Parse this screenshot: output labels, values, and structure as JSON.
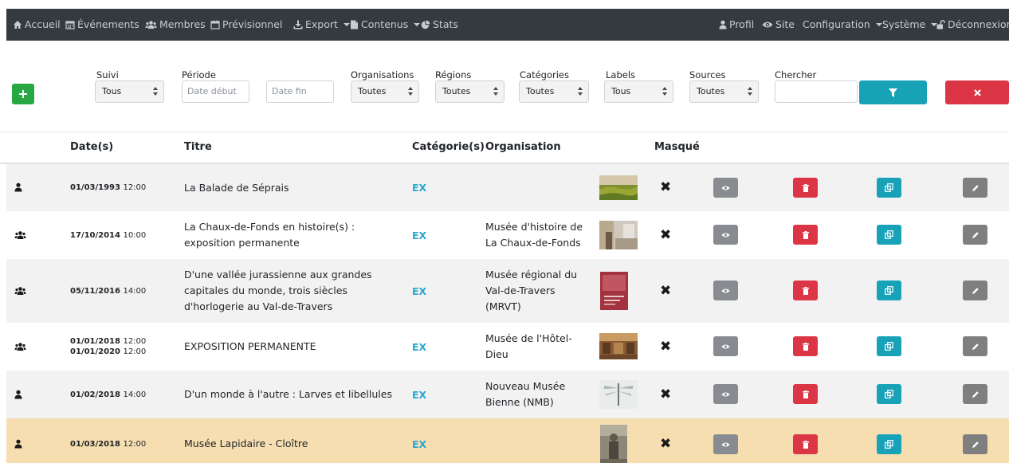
{
  "nav": {
    "left": [
      {
        "label": "Accueil",
        "icon": "home-icon"
      },
      {
        "label": "Événements",
        "icon": "calendar-icon"
      },
      {
        "label": "Membres",
        "icon": "users-icon"
      },
      {
        "label": "Prévisionnel",
        "icon": "calendar-outline-icon"
      },
      {
        "label": "Export",
        "icon": "download-icon",
        "dropdown": true
      },
      {
        "label": "Contenus",
        "icon": "file-icon",
        "dropdown": true
      },
      {
        "label": "Stats",
        "icon": "pie-chart-icon"
      }
    ],
    "right": [
      {
        "label": "Profil",
        "icon": "user-icon"
      },
      {
        "label": "Site",
        "icon": "eye-icon"
      },
      {
        "label": "Configuration",
        "dropdown": true
      },
      {
        "label": "Système",
        "dropdown": true
      },
      {
        "label": "Déconnexion",
        "icon": "unlock-icon"
      }
    ]
  },
  "filters": {
    "suivi": {
      "label": "Suivi",
      "value": "Tous"
    },
    "periode": {
      "label": "Période",
      "start_placeholder": "Date début",
      "end_placeholder": "Date fin"
    },
    "organisations": {
      "label": "Organisations",
      "value": "Toutes"
    },
    "regions": {
      "label": "Régions",
      "value": "Toutes"
    },
    "categories": {
      "label": "Catégories",
      "value": "Toutes"
    },
    "labels": {
      "label": "Labels",
      "value": "Tous"
    },
    "sources": {
      "label": "Sources",
      "value": "Toutes"
    },
    "chercher": {
      "label": "Chercher",
      "value": ""
    }
  },
  "colors": {
    "add_button": "#28a745",
    "filter_button": "#17a2b8",
    "reset_button": "#dc3545",
    "category_link": "#29a7d2",
    "highlight_row": "#f6deb0",
    "navbar": "#343a40"
  },
  "table": {
    "headers": {
      "dates": "Date(s)",
      "titre": "Titre",
      "categories": "Catégorie(s)",
      "organisation": "Organisation",
      "masque": "Masqué"
    },
    "rows": [
      {
        "user_icon": "user-icon",
        "date1": "01/03/1993",
        "time1": "12:00",
        "date2": "",
        "time2": "",
        "title": "La Balade de Séprais",
        "category": "EX",
        "organisation": "",
        "thumb": "field-thumbnail",
        "highlight": false
      },
      {
        "user_icon": "users-icon",
        "date1": "17/10/2014",
        "time1": "10:00",
        "date2": "",
        "time2": "",
        "title": "La Chaux-de-Fonds en histoire(s) : exposition permanente",
        "category": "EX",
        "organisation": "Musée d'histoire de La Chaux-de-Fonds",
        "thumb": "museum-room-thumbnail",
        "highlight": false
      },
      {
        "user_icon": "users-icon",
        "date1": "05/11/2016",
        "time1": "14:00",
        "date2": "",
        "time2": "",
        "title": "D'une vallée jurassienne aux grandes capitales du monde, trois siècles d'horlogerie au Val-de-Travers",
        "category": "EX",
        "organisation": "Musée régional du Val-de-Travers (MRVT)",
        "thumb": "poster-thumbnail",
        "highlight": false
      },
      {
        "user_icon": "users-icon",
        "date1": "01/01/2018",
        "time1": "12:00",
        "date2": "01/01/2020",
        "time2": "12:00",
        "title": "EXPOSITION PERMANENTE",
        "category": "EX",
        "organisation": "Musée de l'Hôtel-Dieu",
        "thumb": "hall-thumbnail",
        "highlight": false
      },
      {
        "user_icon": "user-icon",
        "date1": "01/02/2018",
        "time1": "14:00",
        "date2": "",
        "time2": "",
        "title": "D'un monde à l'autre : Larves et libellules",
        "category": "EX",
        "organisation": "Nouveau Musée Bienne (NMB)",
        "thumb": "dragonfly-thumbnail",
        "highlight": false
      },
      {
        "user_icon": "user-icon",
        "date1": "01/03/2018",
        "time1": "12:00",
        "date2": "",
        "time2": "",
        "title": "Musée Lapidaire - Cloître",
        "category": "EX",
        "organisation": "",
        "thumb": "statue-thumbnail",
        "highlight": true
      }
    ]
  }
}
